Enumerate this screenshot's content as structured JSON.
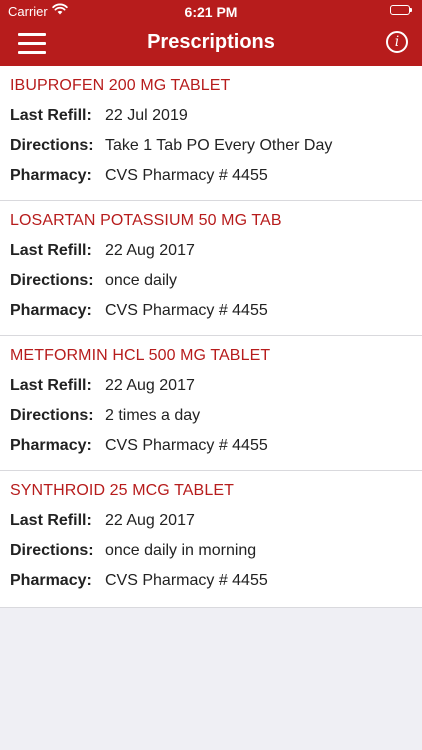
{
  "status": {
    "carrier": "Carrier",
    "time": "6:21 PM"
  },
  "nav": {
    "title": "Prescriptions"
  },
  "labels": {
    "last_refill": "Last Refill:",
    "directions": "Directions:",
    "pharmacy": "Pharmacy:"
  },
  "prescriptions": [
    {
      "name": "IBUPROFEN 200 MG TABLET",
      "last_refill": "22 Jul 2019",
      "directions": "Take 1 Tab PO Every Other Day",
      "pharmacy": "CVS Pharmacy # 4455"
    },
    {
      "name": "LOSARTAN POTASSIUM 50 MG TAB",
      "last_refill": "22 Aug 2017",
      "directions": "once daily",
      "pharmacy": "CVS Pharmacy # 4455"
    },
    {
      "name": "METFORMIN HCL 500 MG TABLET",
      "last_refill": "22 Aug 2017",
      "directions": "2 times a day",
      "pharmacy": "CVS Pharmacy # 4455"
    },
    {
      "name": "SYNTHROID 25 MCG TABLET",
      "last_refill": "22 Aug 2017",
      "directions": "once daily in morning",
      "pharmacy": "CVS Pharmacy # 4455"
    }
  ]
}
